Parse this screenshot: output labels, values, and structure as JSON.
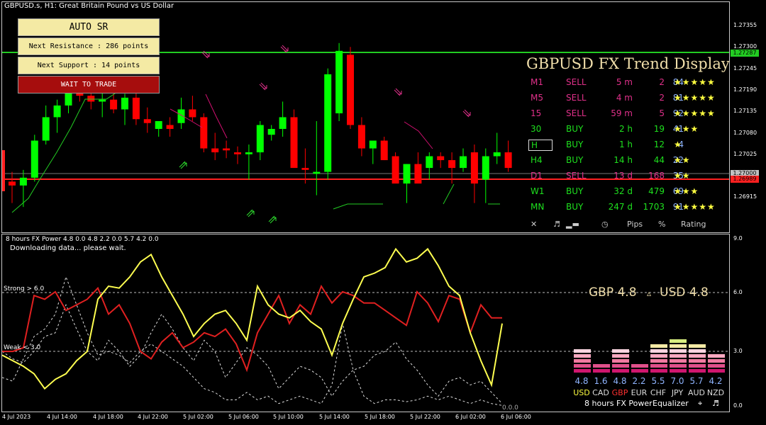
{
  "chart": {
    "title": "GBPUSD.s, H1:  Great Britain Pound vs US Dollar",
    "y_labels": [
      "1.27355",
      "1.27300",
      "1.27245",
      "1.27190",
      "1.27135",
      "1.27080",
      "1.27025",
      "1.26970",
      "1.26915"
    ],
    "price_tags": {
      "resistance": "1.27287",
      "current": "1.27000",
      "support": "1.26989"
    },
    "colors": {
      "bull": "#00ff00",
      "bear": "#ff0000",
      "resistance": "#22cc22",
      "support": "#ff2020",
      "trail": "#22cc22",
      "trail_bear": "#d01070"
    }
  },
  "buttons": {
    "auto_sr": "AUTO SR",
    "next_resistance": "Next Resistance : 286 points",
    "next_support": "Next Support : 14 points",
    "wait": "WAIT TO TRADE"
  },
  "trend": {
    "title": "GBPUSD FX Trend Display",
    "rows": [
      {
        "tf": "M1",
        "signal": "SELL",
        "dur": "5 m",
        "pips": "2",
        "pct": "84",
        "stars": "★★★★★",
        "color": "#e0308a"
      },
      {
        "tf": "M5",
        "signal": "SELL",
        "dur": "4 m",
        "pips": "2",
        "pct": "81",
        "stars": "★★★★★",
        "color": "#e0308a"
      },
      {
        "tf": "15",
        "signal": "SELL",
        "dur": "59 m",
        "pips": "5",
        "pct": "92",
        "stars": "★★★★★",
        "color": "#e0308a"
      },
      {
        "tf": "30",
        "signal": "BUY",
        "dur": "2 h",
        "pips": "19",
        "pct": "41",
        "stars": "★★★",
        "color": "#1ee01e"
      },
      {
        "tf": "H",
        "signal": "BUY",
        "dur": "1 h",
        "pips": "12",
        "pct": "4",
        "stars": "★",
        "color": "#1ee01e"
      },
      {
        "tf": "H4",
        "signal": "BUY",
        "dur": "14 h",
        "pips": "44",
        "pct": "22",
        "stars": "★★",
        "color": "#1ee01e"
      },
      {
        "tf": "D1",
        "signal": "SELL",
        "dur": "13 d",
        "pips": "168",
        "pct": "35",
        "stars": "★★",
        "color": "#e0308a"
      },
      {
        "tf": "W1",
        "signal": "BUY",
        "dur": "32 d",
        "pips": "479",
        "pct": "69",
        "stars": "★★★",
        "color": "#1ee01e"
      },
      {
        "tf": "MN",
        "signal": "BUY",
        "dur": "247 d",
        "pips": "1703",
        "pct": "91",
        "stars": "★★★★★",
        "color": "#1ee01e"
      }
    ],
    "footer": {
      "close": "✕",
      "sound": "♬",
      "pips": "Pips",
      "pct": "%",
      "rating": "Rating",
      "clock": "◷"
    }
  },
  "indicator": {
    "title": "8 hours FX Power 4.8 0.0 4.8 2.2 0.0 5.7 4.2 0.0",
    "message": "Downloading data... please wait.",
    "strong_label": "Strong > 6.0",
    "weak_label": "Weak < 3.0",
    "zero_label": "0.0.0",
    "y_labels": [
      "9.0",
      "6.0",
      "3.0",
      "0.0"
    ],
    "x_labels": [
      "4 Jul 2023",
      "4 Jul 14:00",
      "4 Jul 18:00",
      "4 Jul 22:00",
      "5 Jul 02:00",
      "5 Jul 06:00",
      "5 Jul 10:00",
      "5 Jul 14:00",
      "5 Jul 18:00",
      "5 Jul 22:00",
      "6 Jul 02:00",
      "6 Jul 06:00"
    ],
    "pair": {
      "base": "GBP 4.8",
      "delta": "▵",
      "quote": "USD 4.8"
    },
    "colors": {
      "gbp": "#e02020",
      "usd": "#ffff50"
    }
  },
  "equalizer": {
    "currencies": [
      {
        "code": "USD",
        "value": "4.8",
        "level": 4.8,
        "color": "#ffff40"
      },
      {
        "code": "CAD",
        "value": "1.6",
        "level": 1.6,
        "color": "#dddddd"
      },
      {
        "code": "GBP",
        "value": "4.8",
        "level": 4.8,
        "color": "#ff3030"
      },
      {
        "code": "EUR",
        "value": "2.2",
        "level": 2.2,
        "color": "#dddddd"
      },
      {
        "code": "CHF",
        "value": "5.5",
        "level": 5.5,
        "color": "#dddddd"
      },
      {
        "code": "JPY",
        "value": "7.0",
        "level": 7.0,
        "color": "#dddddd"
      },
      {
        "code": "AUD",
        "value": "5.7",
        "level": 5.7,
        "color": "#dddddd"
      },
      {
        "code": "NZD",
        "value": "4.2",
        "level": 4.2,
        "color": "#dddddd"
      }
    ],
    "footer": {
      "period": "8 hours",
      "name": "FX Power",
      "eq": "Equalizer",
      "target": "⌖",
      "music": "♬",
      "arrow": "◢"
    }
  }
}
